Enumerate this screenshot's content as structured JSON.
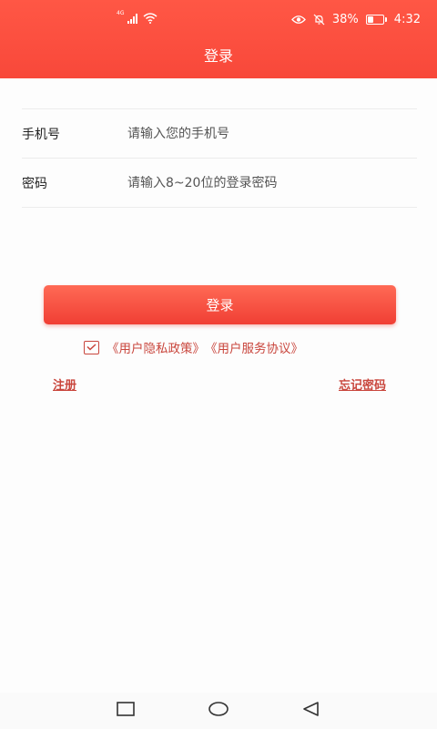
{
  "status_bar": {
    "network_type": "4G",
    "battery_text": "38%",
    "battery_level": 0.38,
    "time": "4:32",
    "icons": [
      "signal-icon",
      "wifi-icon",
      "eye-icon",
      "silent-bell-icon",
      "battery-icon"
    ]
  },
  "header": {
    "title": "登录",
    "gradient_colors": [
      "#ff5745",
      "#f8483a"
    ]
  },
  "form": {
    "phone": {
      "label": "手机号",
      "placeholder": "请输入您的手机号",
      "value": ""
    },
    "password": {
      "label": "密码",
      "placeholder": "请输入8~20位的登录密码",
      "value": ""
    }
  },
  "actions": {
    "login_label": "登录",
    "accent_color": "#f8483a",
    "link_color": "#c9463d"
  },
  "agreement": {
    "checked": true,
    "privacy_policy": "《用户隐私政策》",
    "service_agreement": "《用户服务协议》"
  },
  "links": {
    "register": "注册",
    "forgot_password": "忘记密码"
  },
  "nav_bar": {
    "icons": [
      "recent-apps-icon",
      "home-icon",
      "back-icon"
    ]
  }
}
